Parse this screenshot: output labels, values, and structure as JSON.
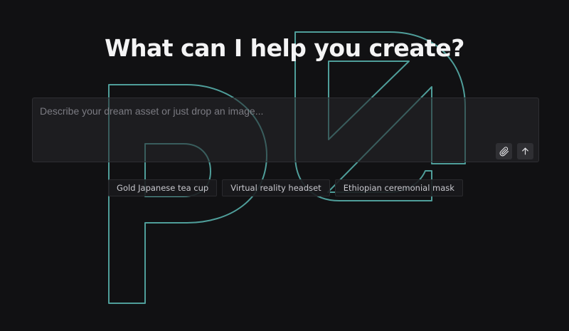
{
  "hero": {
    "title": "What can I help you create?"
  },
  "prompt": {
    "placeholder": "Describe your dream asset or just drop an image...",
    "value": "",
    "attach_icon": "paperclip-icon",
    "send_icon": "arrow-up-icon"
  },
  "suggestions": [
    {
      "label": "Gold Japanese tea cup"
    },
    {
      "label": "Virtual reality headset"
    },
    {
      "label": "Ethiopian ceremonial mask"
    }
  ],
  "colors": {
    "background": "#111113",
    "logo_outline": "#4f9e9a",
    "title_text": "#f4f4f5",
    "placeholder_text": "#7b7b82"
  }
}
